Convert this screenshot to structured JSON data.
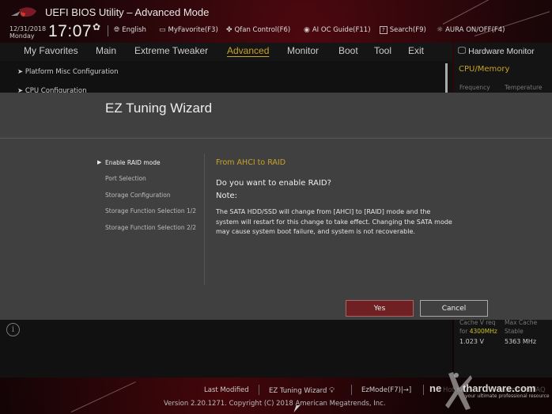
{
  "header": {
    "title": "UEFI BIOS Utility – Advanced Mode",
    "date": "12/31/2018",
    "day": "Monday",
    "time": "17:07",
    "toolbar": [
      {
        "icon": "globe-icon",
        "label": "English"
      },
      {
        "icon": "favorite-icon",
        "label": "MyFavorite(F3)"
      },
      {
        "icon": "fan-icon",
        "label": "Qfan Control(F6)"
      },
      {
        "icon": "ai-chip-icon",
        "label": "AI OC Guide(F11)"
      },
      {
        "icon": "help-icon",
        "label": "Search(F9)"
      },
      {
        "icon": "aura-light-icon",
        "label": "AURA ON/OFF(F4)"
      }
    ]
  },
  "menu": {
    "items": [
      "My Favorites",
      "Main",
      "Extreme Tweaker",
      "Advanced",
      "Monitor",
      "Boot",
      "Tool",
      "Exit"
    ],
    "active": "Advanced"
  },
  "content": {
    "rows": [
      "Platform Misc Configuration",
      "CPU Configuration"
    ]
  },
  "hardware_monitor": {
    "title": "Hardware Monitor",
    "category": "CPU/Memory",
    "labels": [
      "Frequency",
      "Temperature"
    ],
    "cache_label_1": "Cache V req",
    "cache_label_1b": "for",
    "cache_freq": "4300MHz",
    "cache_label_2": "Max Cache",
    "cache_label_2b": "Stable",
    "cache_voltage": "1.023 V",
    "cache_max": "5363 MHz"
  },
  "dialog": {
    "title": "EZ Tuning Wizard",
    "steps": [
      "Enable RAID mode",
      "Port Selection",
      "Storage Configuration",
      "Storage Function Selection 1/2",
      "Storage Function Selection 2/2"
    ],
    "active_step": "Enable RAID mode",
    "subtitle": "From AHCI to RAID",
    "question": "Do you want to enable RAID?",
    "note_label": "Note:",
    "body": "The SATA HDD/SSD will change from [AHCI] to [RAID] mode and the system will restart for this change to take effect. Changing the SATA mode may cause system boot failure, and system is not recoverable.",
    "yes_label": "Yes",
    "cancel_label": "Cancel"
  },
  "footer": {
    "last_modified": "Last Modified",
    "ez_tuning": "EZ Tuning Wizard",
    "ez_mode": "EzMode(F7)|→]",
    "hot_keys": "Hot Keys",
    "search_faq": "Search on FAQ",
    "version": "Version 2.20.1271. Copyright (C) 2018 American Megatrends, Inc."
  },
  "watermark": {
    "brand_prefix": "ne",
    "brand": "thardware.com",
    "tagline": "your ultimate professional resource"
  },
  "colors": {
    "accent_gold": "#c9a227",
    "yes_button": "#6e2022",
    "dialog_bg": "#404040"
  }
}
